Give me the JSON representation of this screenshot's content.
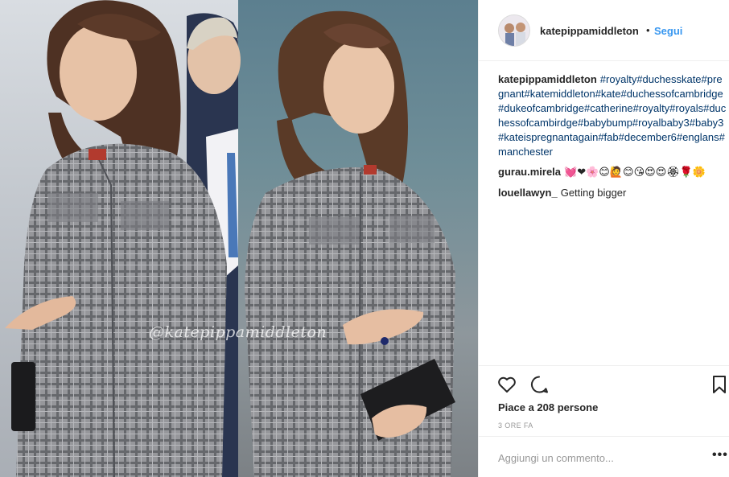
{
  "post": {
    "watermark": "@katepippamiddleton",
    "owner": {
      "username": "katepippamiddleton",
      "separator": "•",
      "follow_label": "Segui"
    },
    "comments": [
      {
        "username": "katepippamiddleton",
        "text": "#royalty#duchesskate#pregnant#katemiddleton#kate#duchessofcambridge#dukeofcambridge#catherine#royalty#royals#duchessofcambirdge#babybump#royalbaby3#baby3#kateispregnantagain#fab#december6#englans#manchester"
      },
      {
        "username": "gurau.mirela",
        "text": "💓❤🌸😊🙋😊😘😍😍🏵🌹🌼"
      },
      {
        "username": "louellawyn_",
        "text": "Getting bigger"
      }
    ],
    "likes_text": "Piace a 208 persone",
    "time_text": "3 ORE FA",
    "add_comment_placeholder": "Aggiungi un commento...",
    "more_label": "•••",
    "icons": {
      "like": "heart-outline-icon",
      "comment": "speech-bubble-icon",
      "save": "bookmark-icon"
    }
  },
  "colors": {
    "link_blue": "#3897f0",
    "hashtag": "#003569",
    "muted": "#999999",
    "text": "#262626",
    "border": "#efefef"
  }
}
